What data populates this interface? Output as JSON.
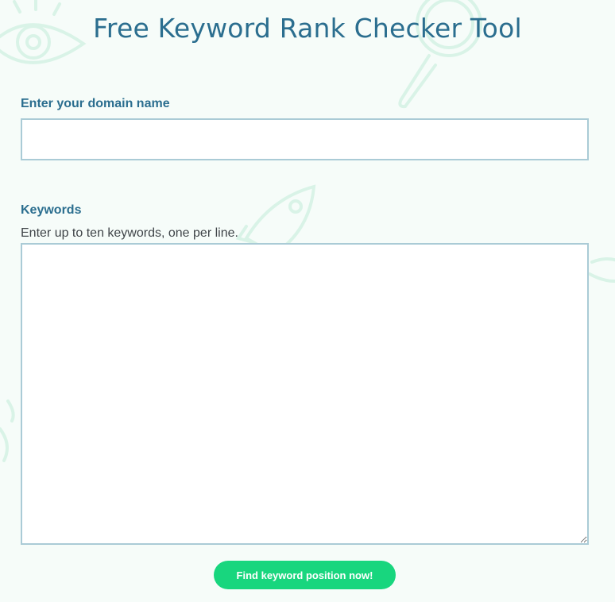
{
  "page": {
    "title": "Free Keyword Rank Checker Tool"
  },
  "form": {
    "domain_label": "Enter your domain name",
    "domain_value": "",
    "domain_placeholder": "",
    "keywords_label": "Keywords",
    "keywords_help": "Enter up to ten keywords, one per line.",
    "keywords_value": "",
    "submit_label": "Find keyword position now!"
  },
  "colors": {
    "background": "#f6fcf9",
    "heading": "#2b6e8f",
    "field_border": "#aacbd6",
    "button": "#18d67e",
    "decor": "#d6f3e6"
  },
  "decor_icons": [
    "eye-icon",
    "magnifier-icon",
    "rocket-icon"
  ]
}
